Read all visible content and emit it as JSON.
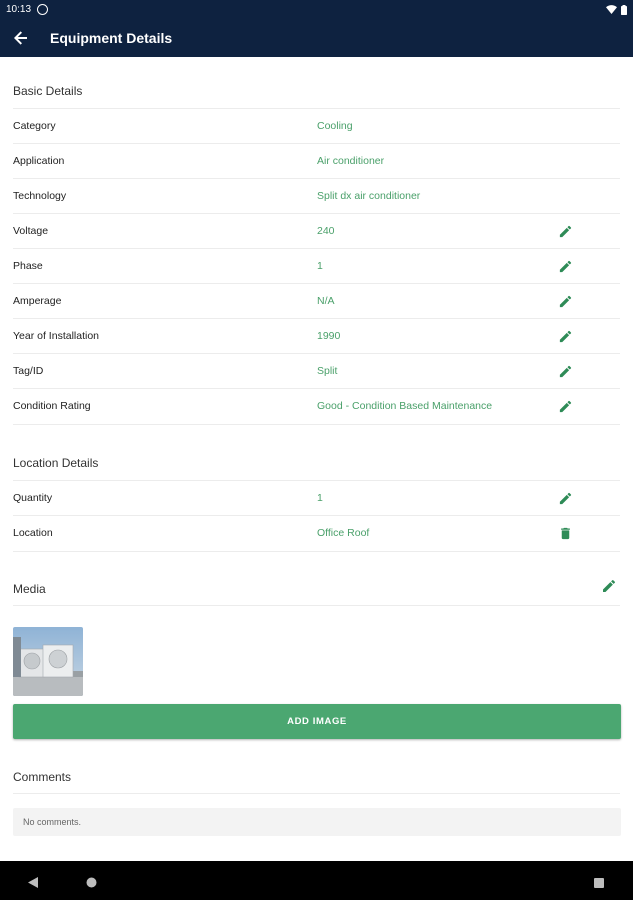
{
  "status_bar": {
    "time": "10:13"
  },
  "app_bar": {
    "title": "Equipment Details"
  },
  "basic_details": {
    "title": "Basic Details",
    "rows": [
      {
        "label": "Category",
        "value": "Cooling"
      },
      {
        "label": "Application",
        "value": "Air conditioner"
      },
      {
        "label": "Technology",
        "value": "Split dx air conditioner"
      },
      {
        "label": "Voltage",
        "value": "240"
      },
      {
        "label": "Phase",
        "value": "1"
      },
      {
        "label": "Amperage",
        "value": "N/A"
      },
      {
        "label": "Year of Installation",
        "value": "1990"
      },
      {
        "label": "Tag/ID",
        "value": "Split"
      },
      {
        "label": "Condition Rating",
        "value": "Good - Condition Based Maintenance"
      }
    ]
  },
  "location_details": {
    "title": "Location Details",
    "rows": [
      {
        "label": "Quantity",
        "value": "1"
      },
      {
        "label": "Location",
        "value": "Office Roof"
      }
    ]
  },
  "media": {
    "title": "Media",
    "add_image_label": "ADD IMAGE"
  },
  "comments": {
    "title": "Comments",
    "empty_text": "No comments."
  },
  "colors": {
    "header_bg": "#0e2240",
    "accent_green": "#4ba771",
    "value_green": "#4aa06a",
    "icon_green": "#2e8b57"
  },
  "icons": {
    "back": "arrow-left-icon",
    "edit": "pencil-icon",
    "delete": "trash-icon",
    "nav_back": "triangle-back-icon",
    "nav_home": "circle-home-icon",
    "nav_recents": "square-recents-icon"
  }
}
